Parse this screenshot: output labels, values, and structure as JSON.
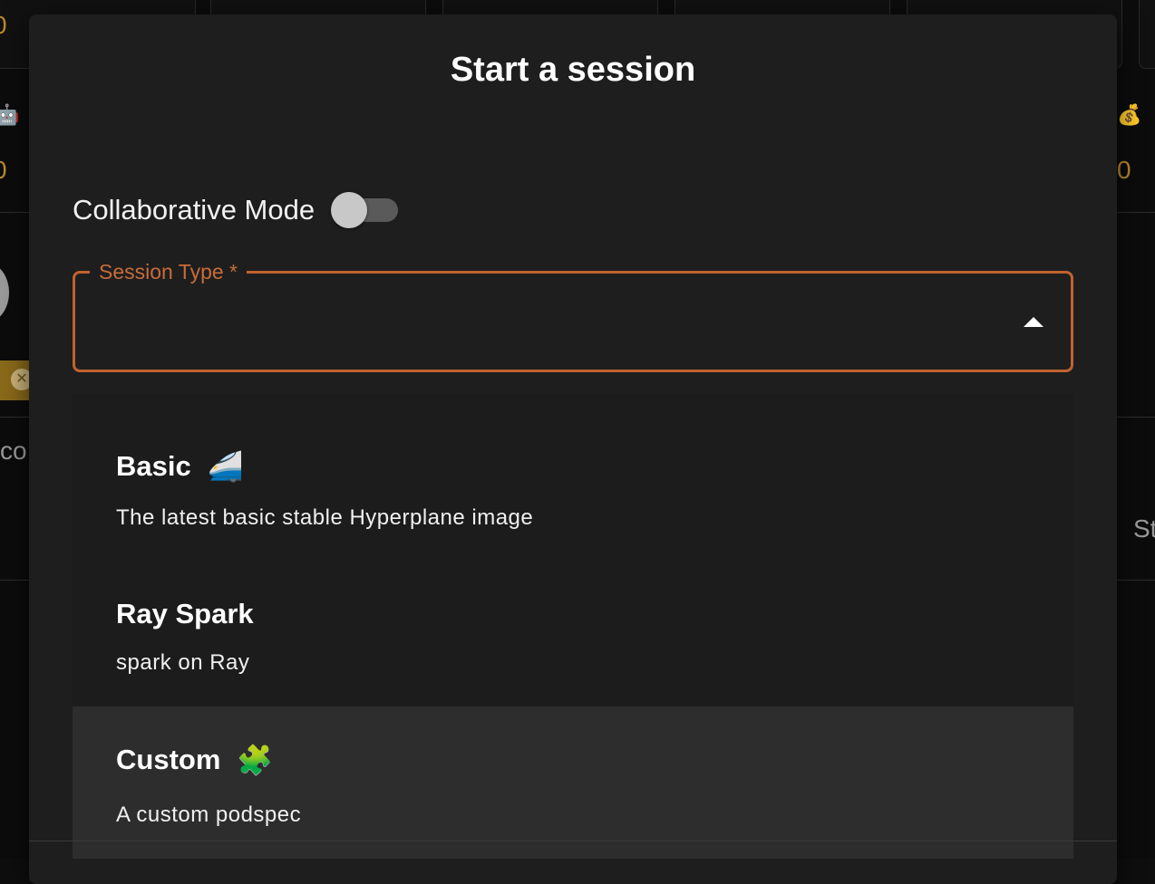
{
  "background": {
    "values": [
      "0",
      "0",
      "0"
    ],
    "labels": [
      "co",
      "St"
    ],
    "emoji": [
      "🤖",
      "💰"
    ]
  },
  "dialog": {
    "title": "Start a session",
    "collaborative": {
      "label": "Collaborative Mode",
      "enabled": false
    },
    "session_type": {
      "label": "Session Type *",
      "value": "",
      "expanded": true,
      "options": [
        {
          "title": "Basic",
          "emoji": "🚄",
          "description": "The latest basic stable Hyperplane image",
          "selected": false
        },
        {
          "title": "Ray Spark",
          "emoji": "",
          "description": "spark on Ray",
          "selected": false
        },
        {
          "title": "Custom",
          "emoji": "🧩",
          "description": "A custom podspec",
          "selected": true
        }
      ]
    }
  },
  "colors": {
    "accent": "#c0622f",
    "dialog_bg": "#1e1e1e",
    "selected_bg": "#2d2d2d",
    "background_gold": "#b98a2c"
  }
}
